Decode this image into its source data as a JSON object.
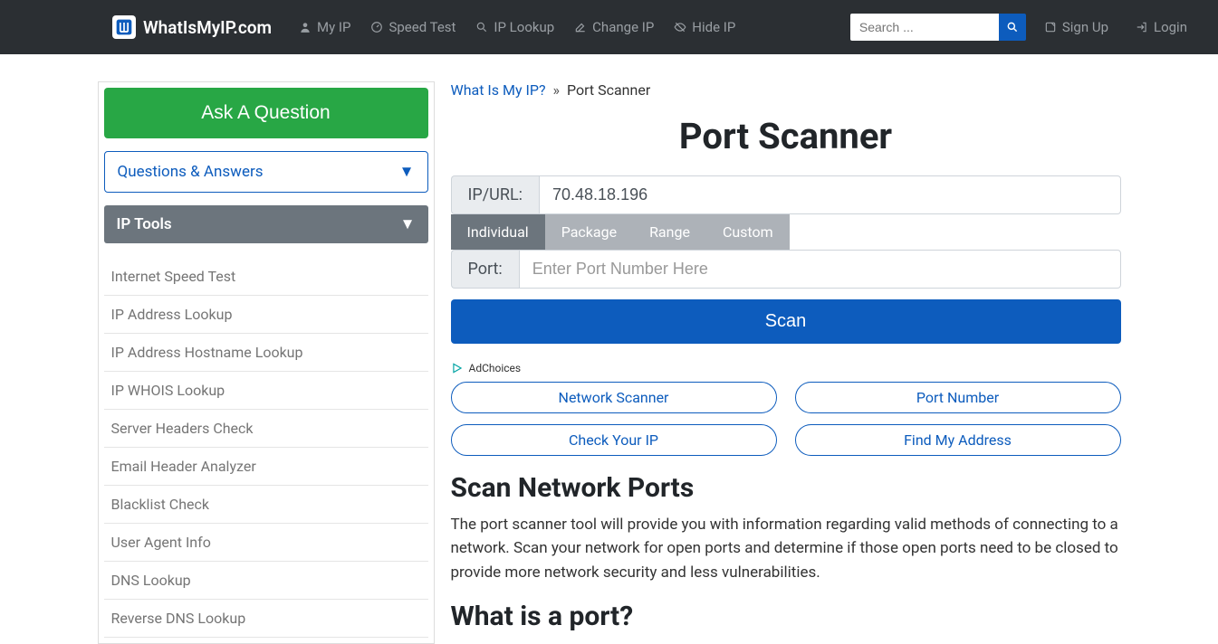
{
  "header": {
    "brand": "WhatIsMyIP.com",
    "nav": [
      {
        "label": "My IP",
        "icon": "user"
      },
      {
        "label": "Speed Test",
        "icon": "gauge"
      },
      {
        "label": "IP Lookup",
        "icon": "search"
      },
      {
        "label": "Change IP",
        "icon": "edit"
      },
      {
        "label": "Hide IP",
        "icon": "eye-slash"
      }
    ],
    "search_placeholder": "Search ...",
    "signup": "Sign Up",
    "login": "Login"
  },
  "sidebar": {
    "ask_button": "Ask A Question",
    "qa_label": "Questions & Answers",
    "tools_label": "IP Tools",
    "tools": [
      "Internet Speed Test",
      "IP Address Lookup",
      "IP Address Hostname Lookup",
      "IP WHOIS Lookup",
      "Server Headers Check",
      "Email Header Analyzer",
      "Blacklist Check",
      "User Agent Info",
      "DNS Lookup",
      "Reverse DNS Lookup"
    ]
  },
  "breadcrumb": {
    "root": "What Is My IP?",
    "sep": "»",
    "current": "Port Scanner"
  },
  "page": {
    "title": "Port Scanner",
    "ip_label": "IP/URL:",
    "ip_value": "70.48.18.196",
    "tabs": [
      "Individual",
      "Package",
      "Range",
      "Custom"
    ],
    "port_label": "Port:",
    "port_placeholder": "Enter Port Number Here",
    "scan_button": "Scan",
    "adchoices": "AdChoices",
    "pills": [
      "Network Scanner",
      "Port Number",
      "Check Your IP",
      "Find My Address"
    ],
    "section1_title": "Scan Network Ports",
    "section1_text": "The port scanner tool will provide you with information regarding valid methods of connecting to a network. Scan your network for open ports and determine if those open ports need to be closed to provide more network security and less vulnerabilities.",
    "section2_title": "What is a port?"
  }
}
